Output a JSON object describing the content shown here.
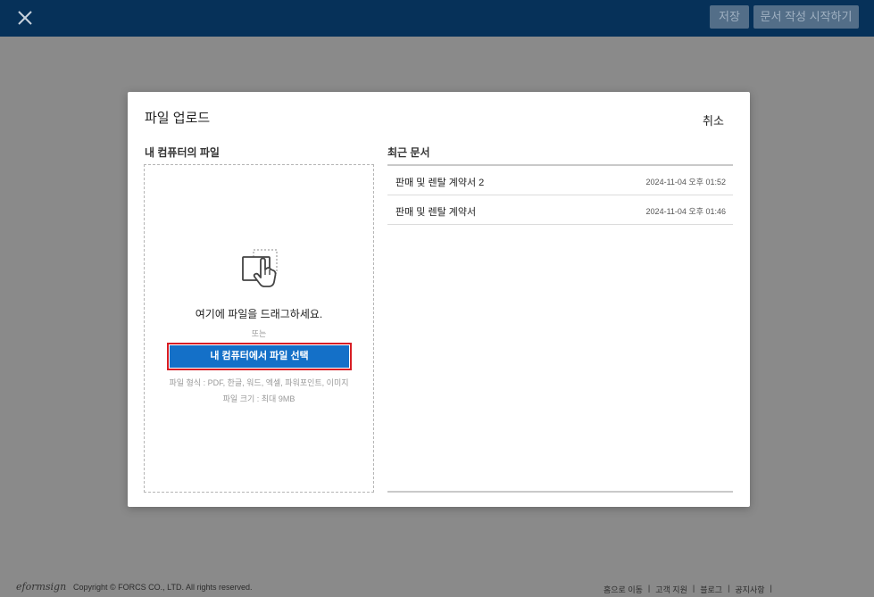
{
  "header": {
    "save_label": "저장",
    "start_label": "문서 작성 시작하기"
  },
  "modal": {
    "title": "파일 업로드",
    "cancel_label": "취소",
    "left_title": "내 컴퓨터의 파일",
    "drop_message": "여기에 파일을 드래그하세요.",
    "or_text": "또는",
    "select_button": "내 컴퓨터에서 파일 선택",
    "file_formats": "파일 형식 : PDF, 한글, 워드, 엑셀, 파워포인트, 이미지",
    "file_size": "파일 크기 : 최대 9MB",
    "right_title": "최근 문서",
    "recent_docs": [
      {
        "name": "판매 및 렌탈 계약서 2",
        "date": "2024-11-04 오후 01:52"
      },
      {
        "name": "판매 및 렌탈 계약서",
        "date": "2024-11-04 오후 01:46"
      }
    ]
  },
  "footer": {
    "logo": "eformsign",
    "copyright": "Copyright © FORCS CO., LTD. All rights reserved.",
    "links": [
      "홈으로 이동",
      "고객 지원",
      "블로그",
      "공지사항"
    ]
  },
  "colors": {
    "header_bg": "#063159",
    "primary_button": "#1470c8",
    "highlight_border": "#d81e25",
    "overlay": "#8a8a8a"
  }
}
